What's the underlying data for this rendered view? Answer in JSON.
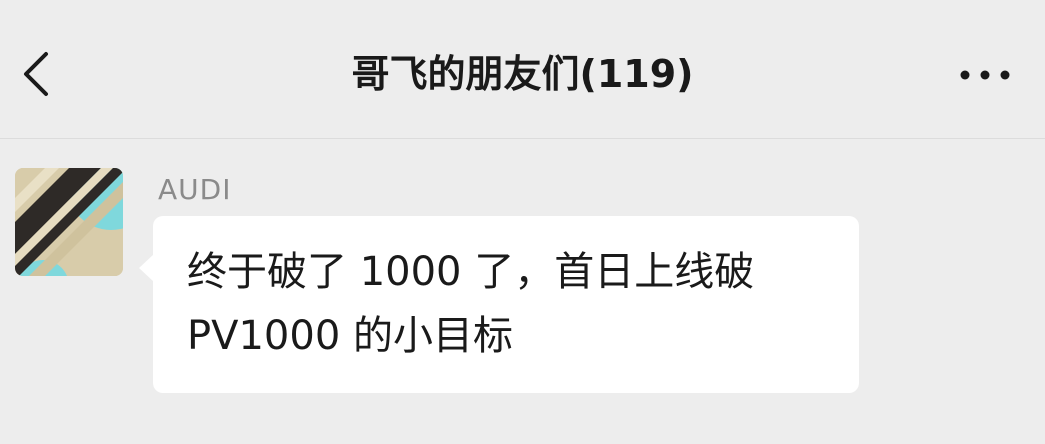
{
  "header": {
    "title": "哥飞的朋友们(119)",
    "back_icon": "chevron-left-icon",
    "more_icon": "ellipsis-icon"
  },
  "message": {
    "sender": "AUDI",
    "text": "终于破了 1000 了，首日上线破\nPV1000 的小目标"
  },
  "colors": {
    "background": "#ededed",
    "bubble": "#ffffff",
    "text": "#1a1a1a",
    "sender": "#8a8a8a"
  }
}
